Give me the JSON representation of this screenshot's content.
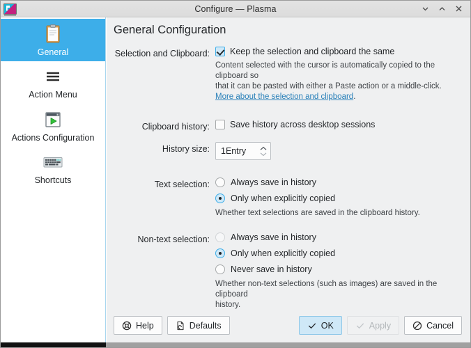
{
  "window": {
    "title": "Configure — Plasma",
    "app_icon": "plasma-icon",
    "controls": [
      {
        "name": "minimize-button",
        "glyph": "chevron-down"
      },
      {
        "name": "maximize-button",
        "glyph": "chevron-up"
      },
      {
        "name": "close-button",
        "glyph": "cross"
      }
    ]
  },
  "sidebar": {
    "items": [
      {
        "label": "General",
        "icon": "clipboard-icon",
        "selected": true
      },
      {
        "label": "Action Menu",
        "icon": "hamburger-menu-icon",
        "selected": false
      },
      {
        "label": "Actions Configuration",
        "icon": "window-run-icon",
        "selected": false
      },
      {
        "label": "Shortcuts",
        "icon": "keyboard-icon",
        "selected": false
      }
    ]
  },
  "main": {
    "page_title": "General Configuration",
    "selection_clipboard": {
      "label": "Selection and Clipboard:",
      "checkbox_label": "Keep the selection and clipboard the same",
      "checked": true,
      "help_line1": "Content selected with the cursor is automatically copied to the clipboard so",
      "help_line2": "that it can be pasted with either a Paste action or a middle-click.",
      "link_text": "More about the selection and clipboard",
      "link_suffix": "."
    },
    "clipboard_history": {
      "label": "Clipboard history:",
      "checkbox_label": "Save history across desktop sessions",
      "checked": false
    },
    "history_size": {
      "label": "History size:",
      "value": "1Entry"
    },
    "text_selection": {
      "label": "Text selection:",
      "options": [
        {
          "label": "Always save in history",
          "selected": false
        },
        {
          "label": "Only when explicitly copied",
          "selected": true
        }
      ],
      "help": "Whether text selections are saved in the clipboard history."
    },
    "nontext_selection": {
      "label": "Non-text selection:",
      "options": [
        {
          "label": "Always save in history",
          "selected": false,
          "dim": true
        },
        {
          "label": "Only when explicitly copied",
          "selected": true
        },
        {
          "label": "Never save in history",
          "selected": false
        }
      ],
      "help_line1": "Whether non-text selections (such as images) are saved in the clipboard",
      "help_line2": "history."
    }
  },
  "buttons": {
    "help": {
      "label": "Help",
      "icon": "lifebuoy-icon"
    },
    "defaults": {
      "label": "Defaults",
      "icon": "document-revert-icon"
    },
    "ok": {
      "label": "OK",
      "icon": "check-icon",
      "primary": true
    },
    "apply": {
      "label": "Apply",
      "icon": "check-icon",
      "disabled": true
    },
    "cancel": {
      "label": "Cancel",
      "icon": "no-entry-icon"
    }
  },
  "colors": {
    "accent": "#3daee9",
    "window_bg": "#eff0f1",
    "sidebar_bg": "#ffffff",
    "link": "#2980b9"
  }
}
